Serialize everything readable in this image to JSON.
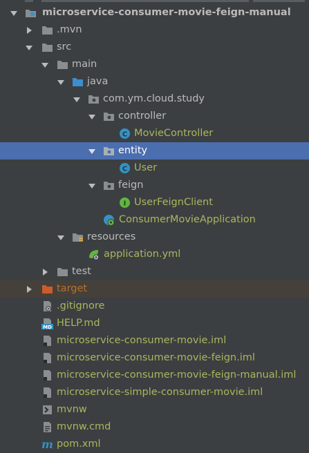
{
  "colors": {
    "background": "#3c3f41",
    "selection": "#4b6eaf",
    "excluded_row": "#45403a",
    "text_default": "#bbbbbb",
    "text_vcs_added": "#a9b75e",
    "text_excluded": "#b5722d",
    "folder": "#8a8e91",
    "source_folder": "#3b8fcc",
    "excluded_folder": "#cc5c2a",
    "class_icon": "#3592c4",
    "interface_icon": "#62b543"
  },
  "tree": {
    "project": {
      "label": "microservice-consumer-movie-feign-manual",
      "icon": "module-icon",
      "state": "expanded"
    },
    "mvn": {
      "label": ".mvn",
      "icon": "folder-icon",
      "state": "collapsed"
    },
    "src": {
      "label": "src",
      "icon": "folder-icon",
      "state": "expanded"
    },
    "main": {
      "label": "main",
      "icon": "folder-icon",
      "state": "expanded"
    },
    "java": {
      "label": "java",
      "icon": "source-folder-icon",
      "state": "expanded"
    },
    "package": {
      "label": "com.ym.cloud.study",
      "icon": "package-icon",
      "state": "expanded"
    },
    "controller": {
      "label": "controller",
      "icon": "package-icon",
      "state": "expanded"
    },
    "movie_controller": {
      "label": "MovieController",
      "icon": "class-icon",
      "badge": "C"
    },
    "entity": {
      "label": "entity",
      "icon": "package-icon",
      "state": "expanded",
      "selected": true
    },
    "user": {
      "label": "User",
      "icon": "class-icon",
      "badge": "C"
    },
    "feign": {
      "label": "feign",
      "icon": "package-icon",
      "state": "expanded"
    },
    "user_feign_client": {
      "label": "UserFeignClient",
      "icon": "interface-icon",
      "badge": "I"
    },
    "consumer_app": {
      "label": "ConsumerMovieApplication",
      "icon": "spring-boot-class-icon"
    },
    "resources": {
      "label": "resources",
      "icon": "resources-folder-icon",
      "state": "expanded"
    },
    "application_yml": {
      "label": "application.yml",
      "icon": "spring-yml-icon"
    },
    "test": {
      "label": "test",
      "icon": "folder-icon",
      "state": "collapsed"
    },
    "target": {
      "label": "target",
      "icon": "excluded-folder-icon",
      "state": "collapsed"
    },
    "gitignore": {
      "label": ".gitignore",
      "icon": "gitignore-file-icon"
    },
    "help_md": {
      "label": "HELP.md",
      "icon": "markdown-file-icon",
      "badge": "MD"
    },
    "iml_1": {
      "label": "microservice-consumer-movie.iml",
      "icon": "iml-file-icon"
    },
    "iml_2": {
      "label": "microservice-consumer-movie-feign.iml",
      "icon": "iml-file-icon"
    },
    "iml_3": {
      "label": "microservice-consumer-movie-feign-manual.iml",
      "icon": "iml-file-icon"
    },
    "iml_4": {
      "label": "microservice-simple-consumer-movie.iml",
      "icon": "iml-file-icon"
    },
    "mvnw": {
      "label": "mvnw",
      "icon": "shell-script-icon"
    },
    "mvnw_cmd": {
      "label": "mvnw.cmd",
      "icon": "cmd-file-icon"
    },
    "pom": {
      "label": "pom.xml",
      "icon": "maven-pom-icon",
      "badge": "m"
    }
  }
}
